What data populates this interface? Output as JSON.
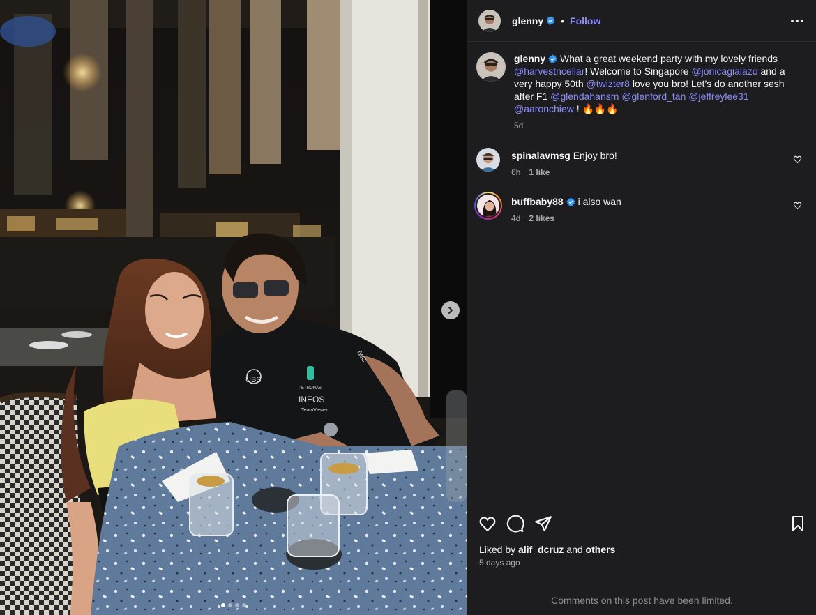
{
  "photo": {
    "jersey_texts": [
      "UBS",
      "PETRONAS",
      "INEOS",
      "TeamViewer",
      "IWC"
    ],
    "carousel": {
      "total": 4,
      "active": 0
    }
  },
  "post": {
    "author": "glenny",
    "follow_label": "Follow",
    "separator": "•",
    "caption": {
      "username": "glenny",
      "t1": " What a great weekend party with my lovely friends ",
      "m1": "@harvestncellar",
      "t2": "! Welcome to Singapore ",
      "m2": "@jonicagialazo",
      "t3": " and a very happy 50th ",
      "m3": "@twizter8",
      "t4": " love you bro! Let’s do another sesh after F1 ",
      "m4": "@glendahansm",
      "m5": "@glenford_tan",
      "m6": "@jeffreylee31",
      "m7": "@aaronchiew",
      "t5": " ! 🔥🔥🔥",
      "time": "5d"
    },
    "comments": [
      {
        "username": "spinalavmsg",
        "text": " Enjoy bro!",
        "time": "6h",
        "likes": "1 like"
      },
      {
        "username": "buffbaby88",
        "text": " i also wan",
        "time": "4d",
        "likes": "2 likes"
      }
    ],
    "liked_by": {
      "prefix": "Liked by ",
      "user": "alif_dcruz",
      "middle": " and ",
      "others": "others"
    },
    "posted_ago": "5 days ago",
    "comments_limited": "Comments on this post have been limited."
  },
  "icons": {
    "verified": "verified-badge-icon",
    "more": "more-horizontal-icon",
    "like": "heart-icon",
    "comment": "comment-bubble-icon",
    "share": "share-plane-icon",
    "save": "bookmark-icon",
    "next": "chevron-right-icon"
  },
  "colors": {
    "link": "#8b8bff",
    "verified": "#3897f0",
    "panel": "#1d1d20",
    "muted": "#a8a8a8"
  }
}
